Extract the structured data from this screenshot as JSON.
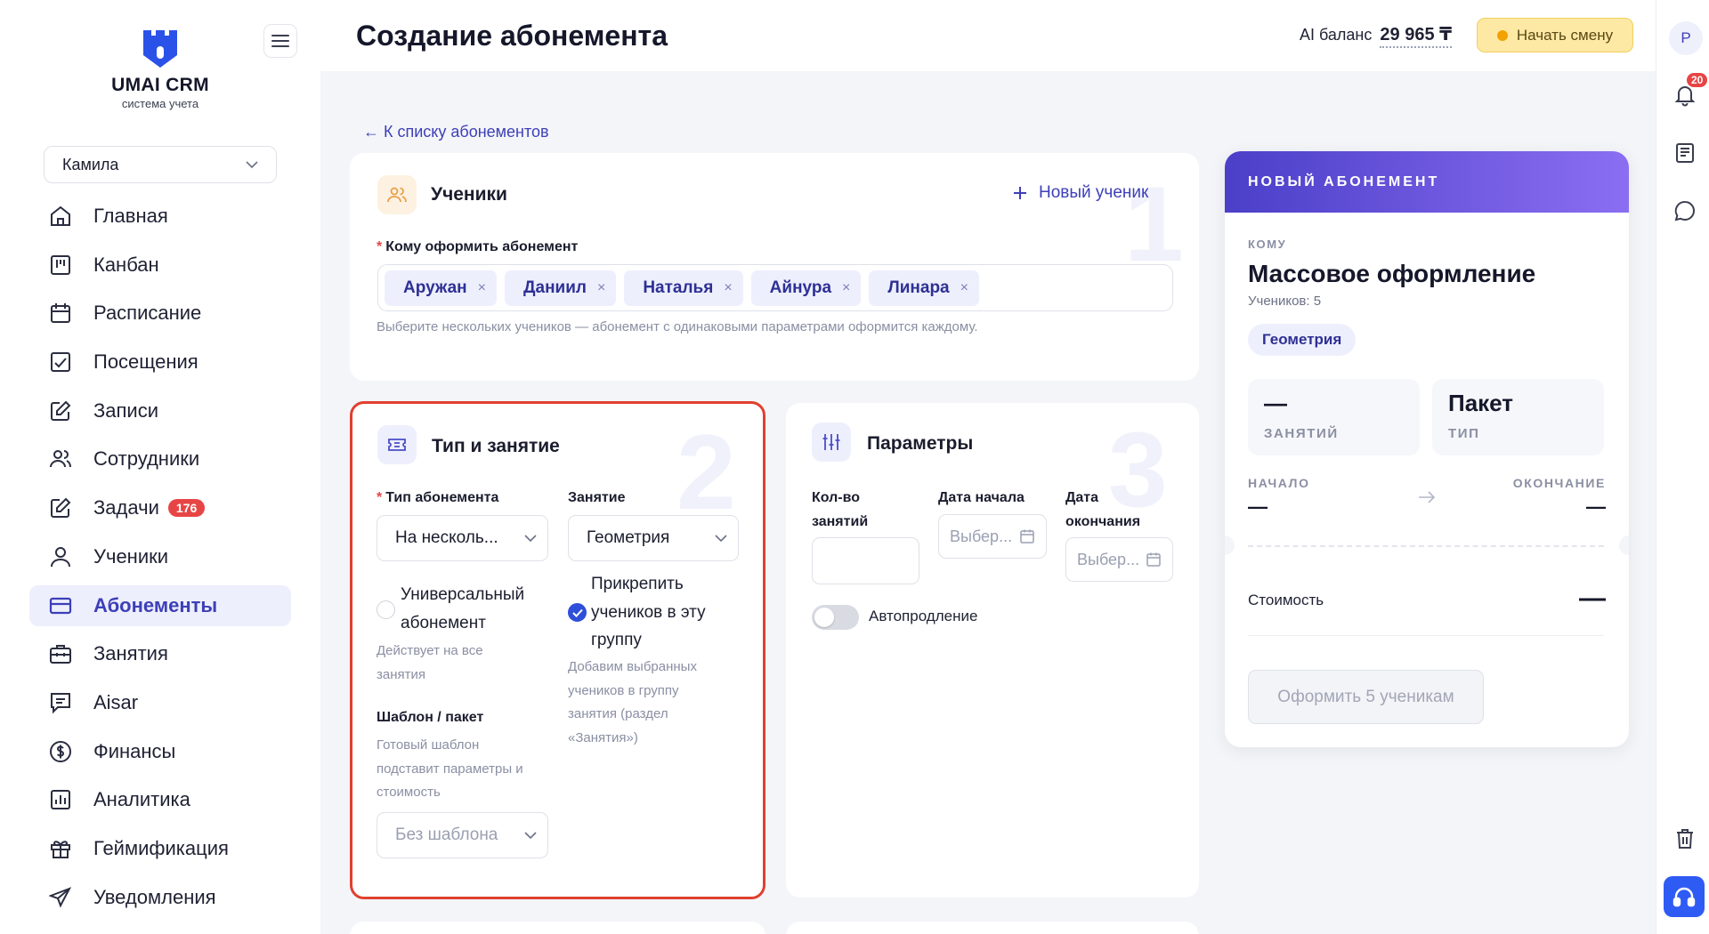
{
  "brand": {
    "name": "UMAI CRM",
    "tagline": "система учета",
    "color": "#2b52e8"
  },
  "sidebar": {
    "user": "Камила",
    "items": [
      {
        "label": "Главная",
        "icon": "home-icon"
      },
      {
        "label": "Канбан",
        "icon": "kanban-icon"
      },
      {
        "label": "Расписание",
        "icon": "calendar-icon"
      },
      {
        "label": "Посещения",
        "icon": "attendance-icon"
      },
      {
        "label": "Записи",
        "icon": "edit-icon"
      },
      {
        "label": "Сотрудники",
        "icon": "staff-icon"
      },
      {
        "label": "Задачи",
        "icon": "tasks-icon",
        "badge": "176"
      },
      {
        "label": "Ученики",
        "icon": "student-icon"
      },
      {
        "label": "Абонементы",
        "icon": "card-icon",
        "active": true
      },
      {
        "label": "Занятия",
        "icon": "briefcase-icon"
      },
      {
        "label": "Aisar",
        "icon": "chat-icon"
      },
      {
        "label": "Финансы",
        "icon": "dollar-icon"
      },
      {
        "label": "Аналитика",
        "icon": "analytics-icon"
      },
      {
        "label": "Геймификация",
        "icon": "gift-icon"
      },
      {
        "label": "Уведомления",
        "icon": "send-icon"
      }
    ]
  },
  "header": {
    "title": "Создание абонемента",
    "ai_label": "AI баланс",
    "ai_value": "29 965 ₸",
    "start_shift": "Начать смену"
  },
  "rail": {
    "avatar": "Р",
    "notifications_count": "20"
  },
  "back_link": "← К списку абонементов",
  "students_card": {
    "number": "1",
    "title": "Ученики",
    "new_student": "Новый ученик",
    "field_label": "Кому оформить абонемент",
    "chips": [
      "Аружан",
      "Даниил",
      "Наталья",
      "Айнура",
      "Линара"
    ],
    "chip_remove": "×",
    "hint": "Выберите нескольких учеников — абонемент с одинаковыми параметрами оформится каждому."
  },
  "type_card": {
    "number": "2",
    "title": "Тип и занятие",
    "type_label": "Тип абонемента",
    "type_value": "На несколь...",
    "lesson_label": "Занятие",
    "lesson_value": "Геометрия",
    "universal_label_1": "Универсальный",
    "universal_label_2": "абонемент",
    "universal_hint_1": "Действует на все",
    "universal_hint_2": "занятия",
    "attach_label_1": "Прикрепить",
    "attach_label_2": "учеников в эту",
    "attach_label_3": "группу",
    "attach_hint_1": "Добавим выбранных",
    "attach_hint_2": "учеников в группу",
    "attach_hint_3": "занятия (раздел",
    "attach_hint_4": "«Занятия»)",
    "template_label": "Шаблон / пакет",
    "template_hint_1": "Готовый шаблон",
    "template_hint_2": "подставит параметры и",
    "template_hint_3": "стоимость",
    "template_value": "Без шаблона"
  },
  "params_card": {
    "number": "3",
    "title": "Параметры",
    "count_label_1": "Кол-во",
    "count_label_2": "занятий",
    "count_value": "",
    "start_label": "Дата начала",
    "start_placeholder": "Выбер...",
    "end_label_1": "Дата",
    "end_label_2": "окончания",
    "end_placeholder": "Выбер...",
    "autorenew_label": "Автопродление",
    "autorenew_on": false
  },
  "summary": {
    "header": "НОВЫЙ АБОНЕМЕНТ",
    "to_label": "КОМУ",
    "title": "Массовое оформление",
    "count": "Учеников: 5",
    "tag": "Геометрия",
    "tile_lessons_value": "—",
    "tile_lessons_label": "ЗАНЯТИЙ",
    "tile_type_value": "Пакет",
    "tile_type_label": "ТИП",
    "start_label": "НАЧАЛО",
    "end_label": "ОКОНЧАНИЕ",
    "start_value": "—",
    "end_value": "—",
    "cost_label": "Стоимость",
    "cost_value": "—",
    "button": "Оформить 5 ученикам"
  },
  "colors": {
    "accent": "#3d3fb8",
    "highlight_border": "#e0402f",
    "danger": "#e74545"
  }
}
